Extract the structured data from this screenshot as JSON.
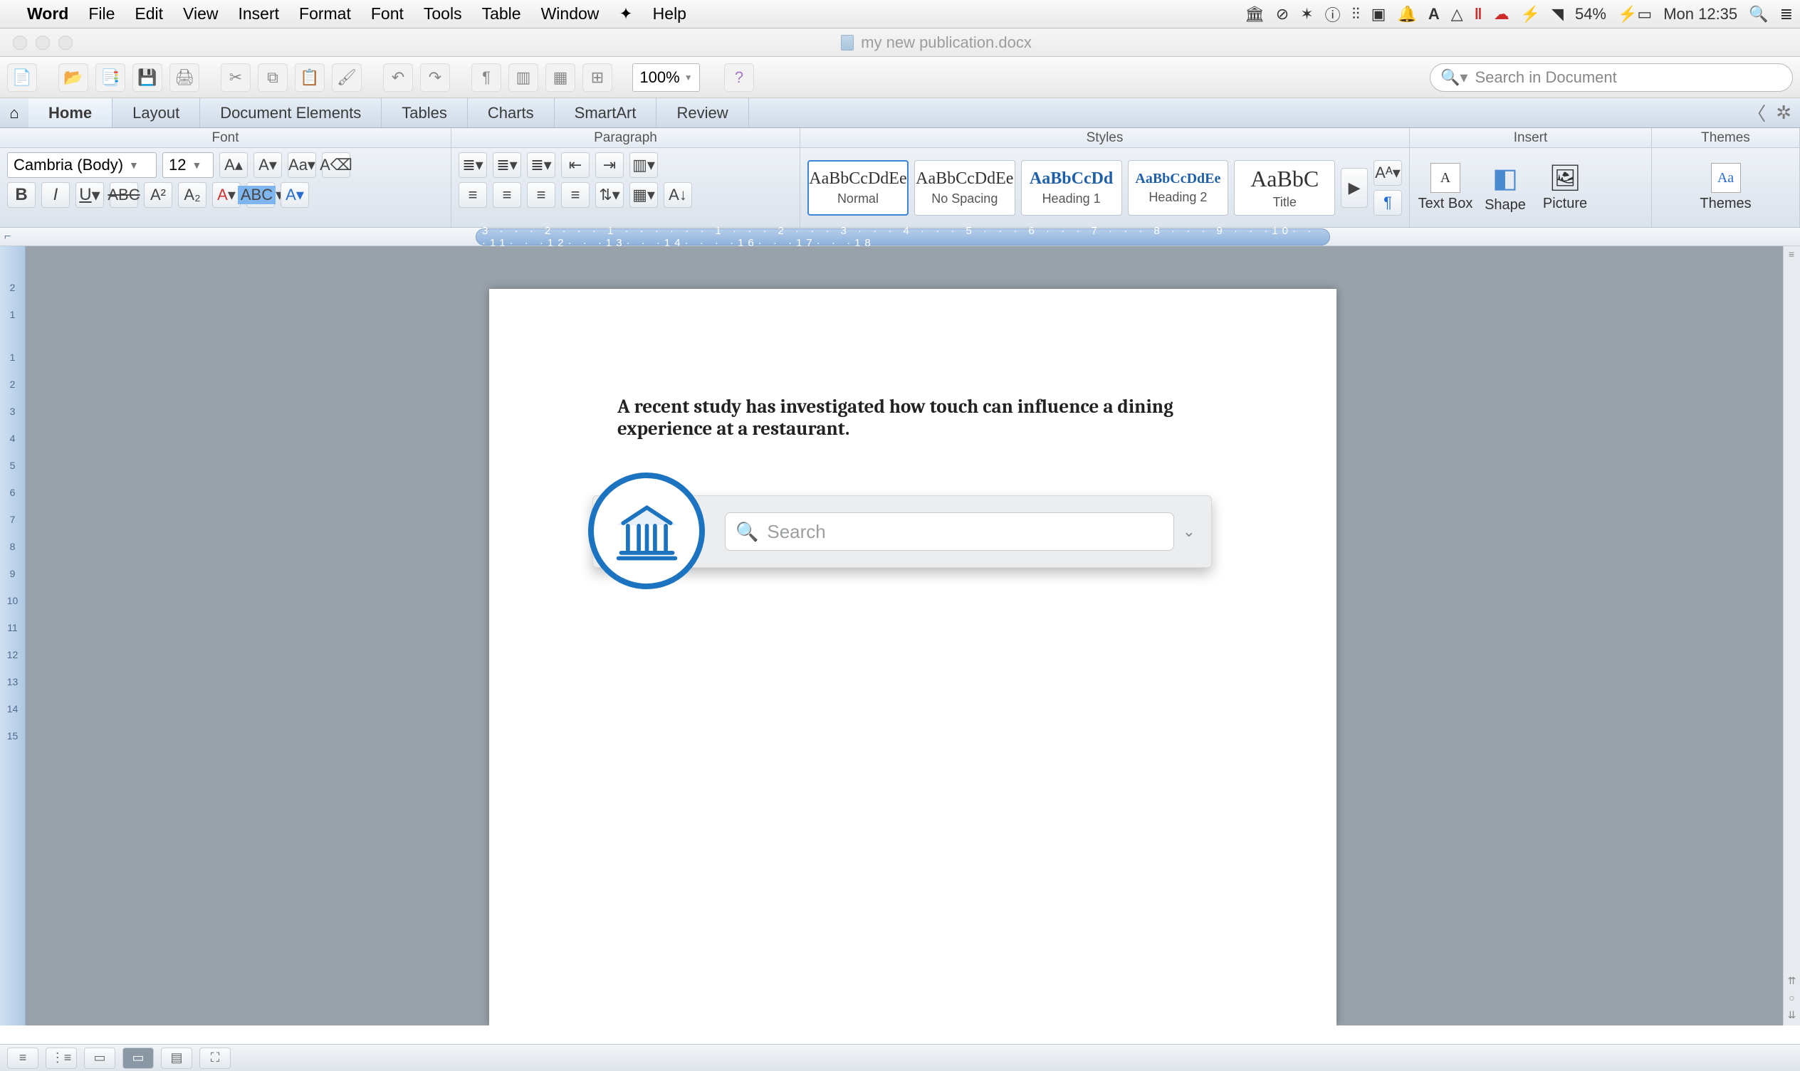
{
  "menubar": {
    "app": "Word",
    "items": [
      "File",
      "Edit",
      "View",
      "Insert",
      "Format",
      "Font",
      "Tools",
      "Table",
      "Window"
    ],
    "help": "Help",
    "battery": "54%",
    "clock": "Mon 12:35"
  },
  "titlebar": {
    "filename": "my new publication.docx"
  },
  "toolbar": {
    "zoom": "100%",
    "search_placeholder": "Search in Document"
  },
  "tabs": {
    "items": [
      "Home",
      "Layout",
      "Document Elements",
      "Tables",
      "Charts",
      "SmartArt",
      "Review"
    ],
    "active": 0
  },
  "groups": {
    "font": "Font",
    "paragraph": "Paragraph",
    "styles": "Styles",
    "insert": "Insert",
    "themes": "Themes"
  },
  "font": {
    "name": "Cambria (Body)",
    "size": "12"
  },
  "styles_gallery": [
    {
      "preview": "AaBbCcDdEe",
      "label": "Normal",
      "blue": false,
      "active": true
    },
    {
      "preview": "AaBbCcDdEe",
      "label": "No Spacing",
      "blue": false,
      "active": false
    },
    {
      "preview": "AaBbCcDd",
      "label": "Heading 1",
      "blue": true,
      "active": false
    },
    {
      "preview": "AaBbCcDdEe",
      "label": "Heading 2",
      "blue": true,
      "active": false
    },
    {
      "preview": "AaBbC",
      "label": "Title",
      "blue": false,
      "active": false
    }
  ],
  "insert_buttons": {
    "textbox": "Text Box",
    "shape": "Shape",
    "picture": "Picture"
  },
  "themes_button": "Themes",
  "document": {
    "body": "A recent study has investigated how touch can influence a dining experience at a restaurant."
  },
  "citation_widget": {
    "placeholder": "Search"
  },
  "ruler_h": "3 · · · 2 · · · 1 · · ·     · · · 1 · · · 2 · · · 3 · · · 4 · · · 5 · · · 6 · · · 7 · · · 8 · · · 9 · · ·10· · ·11· · ·12· · ·13· · ·14· ·     · ·16· · ·17· · ·18",
  "ruler_v": [
    "2",
    "1",
    "",
    "1",
    "2",
    "3",
    "4",
    "5",
    "6",
    "7",
    "8",
    "9",
    "10",
    "11",
    "12",
    "13",
    "14",
    "15"
  ]
}
